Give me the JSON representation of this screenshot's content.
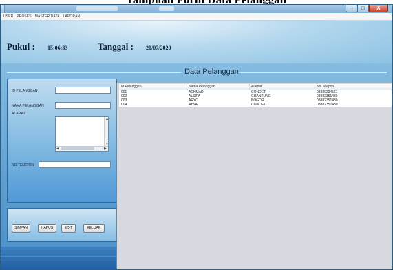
{
  "top_caption": "Tampilan Form Data Pelanggan",
  "menu": [
    "USER",
    "PROSES",
    "MASTER DATA",
    "LAPORAN"
  ],
  "window_controls": {
    "minimize": "–",
    "maximize": "□",
    "close": "X"
  },
  "header": {
    "pukul_label": "Pukul :",
    "pukul_value": "15:06:33",
    "tanggal_label": "Tanggal :",
    "tanggal_value": "20/07/2020"
  },
  "main_title": "Data Pelanggan",
  "form": {
    "id_label": "ID PELANGGAN",
    "id_value": "",
    "nama_label": "NAMA PELANGGAN",
    "nama_value": "",
    "alamat_label": "ALAMAT",
    "alamat_value": "",
    "telepon_label": "NO TELEPON",
    "telepon_value": ""
  },
  "buttons": {
    "simpan": "SIMPAN",
    "hapus": "HAPUS",
    "edit": "EDIT",
    "keluar": "KELUAR"
  },
  "table": {
    "columns": [
      "Id Pelanggan",
      "Nama Pelanggan",
      "Alamat",
      "No Telepon"
    ],
    "rows": [
      [
        "001",
        "ACHMAD",
        "CONDET",
        "08889234561"
      ],
      [
        "002",
        "ALSIFA",
        "CIJANTUNG",
        "08882351430"
      ],
      [
        "003",
        "ARYO",
        "BOGOR",
        "08882351430"
      ],
      [
        "004",
        "AYSA",
        "CONDET",
        "08882351430"
      ]
    ]
  }
}
